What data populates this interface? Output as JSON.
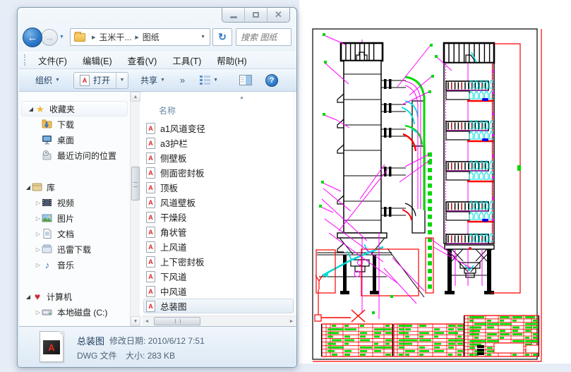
{
  "window": {
    "address": {
      "crumbs": [
        "玉米干...",
        "图纸"
      ],
      "search_placeholder": "搜索 图纸"
    },
    "menu": [
      "文件(F)",
      "编辑(E)",
      "查看(V)",
      "工具(T)",
      "帮助(H)"
    ],
    "toolbar": {
      "organize": "组织",
      "open": "打开",
      "share": "共享",
      "overflow": "»"
    },
    "sidebar": {
      "groups": [
        {
          "label": "收藏夹",
          "items": [
            {
              "label": "下载",
              "icon": "download-folder",
              "expandable": false
            },
            {
              "label": "桌面",
              "icon": "desktop",
              "expandable": false
            },
            {
              "label": "最近访问的位置",
              "icon": "recent-places",
              "expandable": false
            }
          ]
        },
        {
          "label": "库",
          "items": [
            {
              "label": "视频",
              "icon": "videos",
              "expandable": true
            },
            {
              "label": "图片",
              "icon": "pictures",
              "expandable": true
            },
            {
              "label": "文档",
              "icon": "documents",
              "expandable": true
            },
            {
              "label": "迅雷下载",
              "icon": "thunder",
              "expandable": true
            },
            {
              "label": "音乐",
              "icon": "music",
              "expandable": true
            }
          ]
        },
        {
          "label": "计算机",
          "items": [
            {
              "label": "本地磁盘 (C:)",
              "icon": "disk",
              "expandable": true
            }
          ]
        }
      ]
    },
    "filelist": {
      "header": "名称",
      "files": [
        "a1风道变径",
        "a3护栏",
        "侧壁板",
        "侧面密封板",
        "顶板",
        "风道壁板",
        "干燥段",
        "角状管",
        "上风道",
        "上下密封板",
        "下风道",
        "中风道",
        "总装图"
      ],
      "selected_index": 12
    },
    "details": {
      "name": "总装图",
      "modified_label": "修改日期:",
      "modified_value": "2010/6/12 7:51",
      "type": "DWG 文件",
      "size_label": "大小:",
      "size_value": "283 KB"
    }
  },
  "icons": {
    "close": "✕",
    "back": "←",
    "forward": "→",
    "refresh": "↻",
    "dropdown": "▼",
    "crumb_sep": "▶",
    "overflow": "»",
    "help": "?",
    "sort_asc": "▲",
    "scroll_up": "▲",
    "scroll_down": "▼",
    "scroll_left": "◄",
    "scroll_right": "►",
    "tree_expanded": "◢",
    "tree_collapsed": "▷",
    "star": "★",
    "music_note": "♪",
    "heart": "♥",
    "dwg_letter": "A"
  },
  "preview": {
    "kind": "cad-drawing-preview",
    "colors": {
      "outline": "#000000",
      "centerline": "#ff00ff",
      "duct_green": "#00d800",
      "duct_cyan": "#00dcdc",
      "alert_red": "#ff0000",
      "detail_blue": "#0000ee",
      "paper": "#ffffff"
    }
  }
}
